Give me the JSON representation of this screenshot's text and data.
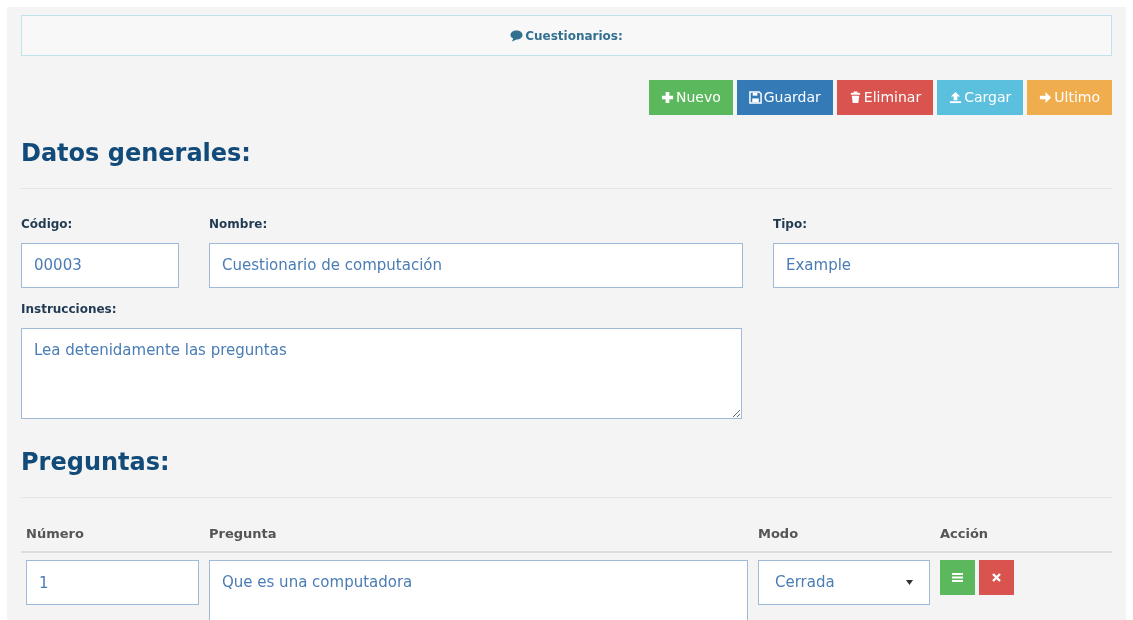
{
  "header": {
    "title": "Cuestionarios:"
  },
  "toolbar": [
    {
      "label": "Nuevo",
      "kind": "new"
    },
    {
      "label": "Guardar",
      "kind": "save"
    },
    {
      "label": "Eliminar",
      "kind": "delete"
    },
    {
      "label": "Cargar",
      "kind": "upload"
    },
    {
      "label": "Ultimo",
      "kind": "last"
    }
  ],
  "general": {
    "heading": "Datos generales:",
    "codigo": {
      "label": "Código:",
      "value": "00003"
    },
    "nombre": {
      "label": "Nombre:",
      "value": "Cuestionario de computación"
    },
    "tipo": {
      "label": "Tipo:",
      "value": "Example"
    },
    "instrucciones": {
      "label": "Instrucciones:",
      "value": "Lea detenidamente las preguntas"
    }
  },
  "questions": {
    "heading": "Preguntas:",
    "columns": [
      "Número",
      "Pregunta",
      "Modo",
      "Acción"
    ],
    "rows": [
      {
        "numero": "1",
        "pregunta": "Que es una computadora",
        "modo": "Cerrada"
      }
    ]
  }
}
